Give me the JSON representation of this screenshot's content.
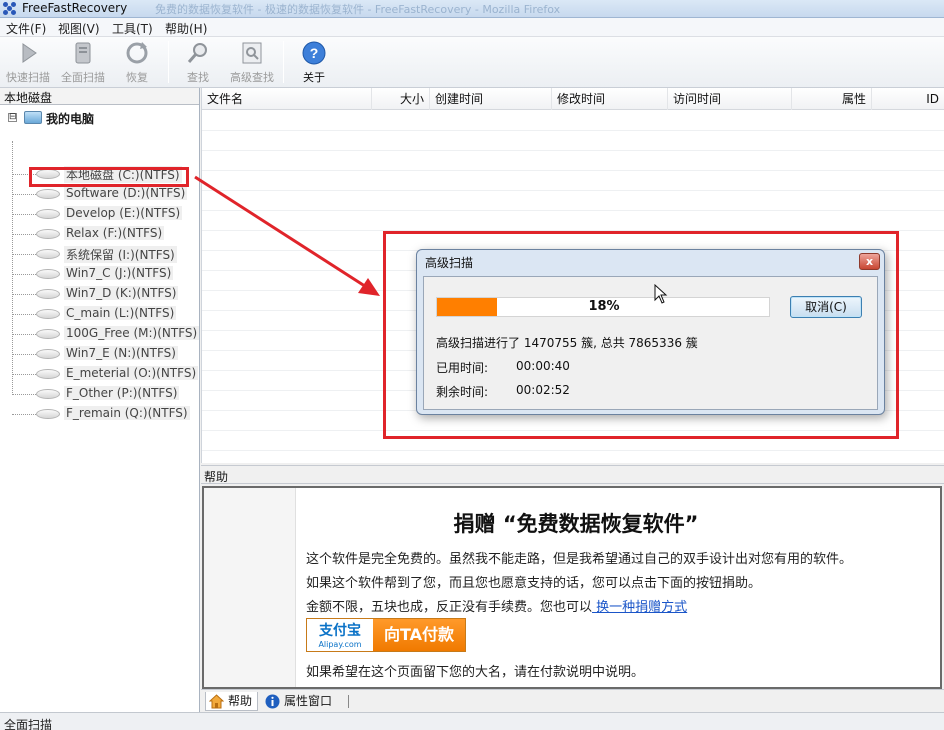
{
  "window": {
    "title": "FreeFastRecovery",
    "title_ghost": "免费的数据恢复软件 - 极速的数据恢复软件 - FreeFastRecovery - Mozilla Firefox"
  },
  "menu": [
    "文件(F)",
    "视图(V)",
    "工具(T)",
    "帮助(H)"
  ],
  "toolbar": {
    "quick_scan": "快速扫描",
    "full_scan": "全面扫描",
    "recover": "恢复",
    "search": "查找",
    "advanced_search": "高级查找",
    "about": "关于"
  },
  "left_panel": {
    "header": "本地磁盘",
    "root_toggle": "⊟",
    "root": "我的电脑",
    "drives": [
      "本地磁盘 (C:)(NTFS)",
      "Software (D:)(NTFS)",
      "Develop (E:)(NTFS)",
      "Relax (F:)(NTFS)",
      "系统保留 (I:)(NTFS)",
      "Win7_C (J:)(NTFS)",
      "Win7_D (K:)(NTFS)",
      "C_main (L:)(NTFS)",
      "100G_Free (M:)(NTFS)",
      "Win7_E (N:)(NTFS)",
      "E_meterial (O:)(NTFS)",
      "F_Other (P:)(NTFS)",
      "F_remain (Q:)(NTFS)"
    ]
  },
  "file_list": {
    "columns": [
      "文件名",
      "大小",
      "创建时间",
      "修改时间",
      "访问时间",
      "属性",
      "ID"
    ]
  },
  "help": {
    "title": "帮助",
    "heading": "捐赠 “免费数据恢复软件”",
    "line1": "这个软件是完全免费的。虽然我不能走路，但是我希望通过自己的双手设计出对您有用的软件。",
    "line2": "如果这个软件帮到了您，而且您也愿意支持的话，您可以点击下面的按钮捐助。",
    "line3_prefix": "金额不限，五块也成，反正没有手续费。您也可以",
    "line3_link": " 换一种捐赠方式",
    "pay_logo_cn": "支付宝",
    "pay_logo_en": "Alipay.com",
    "pay_button": "向TA付款",
    "line4": "如果希望在这个页面留下您的大名，请在付款说明中说明。"
  },
  "tabs": {
    "help": "帮助",
    "properties": "属性窗口"
  },
  "status": "全面扫描",
  "dialog": {
    "title": "高级扫描",
    "close": "x",
    "progress_percent": 18,
    "progress_text": "18%",
    "cancel": "取消(C)",
    "scan_info": "高级扫描进行了 1470755 簇, 总共 7865336 簇",
    "elapsed_label": "已用时间:",
    "elapsed_value": "00:00:40",
    "remaining_label": "剩余时间:",
    "remaining_value": "00:02:52"
  },
  "colors": {
    "progress": "#ff7f00",
    "highlight": "#e0242a",
    "link": "#1a55c8"
  }
}
